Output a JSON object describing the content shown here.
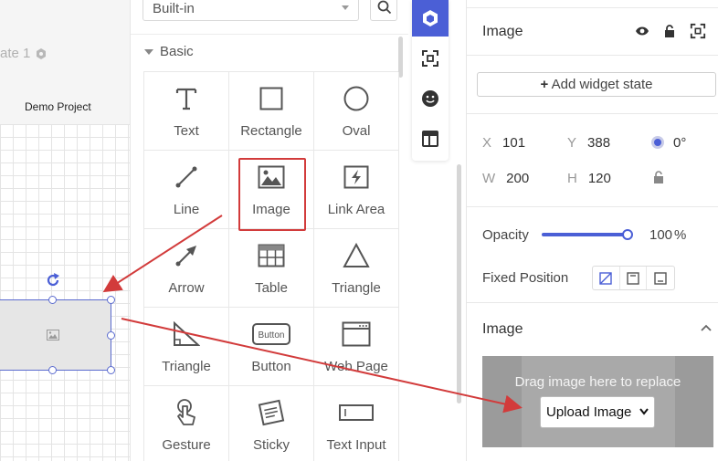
{
  "canvas": {
    "state_label": "ate 1",
    "project_name": "Demo Project"
  },
  "library": {
    "source_select": "Built-in",
    "section": "Basic",
    "widgets": [
      {
        "label": "Text",
        "icon": "text-icon"
      },
      {
        "label": "Rectangle",
        "icon": "rectangle-icon"
      },
      {
        "label": "Oval",
        "icon": "oval-icon"
      },
      {
        "label": "Line",
        "icon": "line-icon"
      },
      {
        "label": "Image",
        "icon": "image-icon"
      },
      {
        "label": "Link Area",
        "icon": "link-area-icon"
      },
      {
        "label": "Arrow",
        "icon": "arrow-icon"
      },
      {
        "label": "Table",
        "icon": "table-icon"
      },
      {
        "label": "Triangle",
        "icon": "triangle-icon"
      },
      {
        "label": "Triangle",
        "icon": "right-triangle-icon"
      },
      {
        "label": "Button",
        "icon": "button-icon"
      },
      {
        "label": "Web Page",
        "icon": "web-page-icon"
      },
      {
        "label": "Gesture",
        "icon": "gesture-icon"
      },
      {
        "label": "Sticky",
        "icon": "sticky-icon"
      },
      {
        "label": "Text Input",
        "icon": "text-input-icon"
      }
    ],
    "button_icon_text": "Button"
  },
  "toolstrip": [
    "widgets-cube-icon",
    "components-icon",
    "emoji-icon",
    "layout-icon"
  ],
  "props": {
    "title": "Image",
    "add_state": "Add widget state",
    "x_label": "X",
    "x": "101",
    "y_label": "Y",
    "y": "388",
    "rotation": "0°",
    "w_label": "W",
    "w": "200",
    "h_label": "H",
    "h": "120",
    "opacity_label": "Opacity",
    "opacity": "100",
    "opacity_unit": "%",
    "fixed_label": "Fixed Position",
    "image_section": "Image",
    "drop_text": "Drag image here to replace",
    "upload_label": "Upload Image"
  },
  "colors": {
    "accent": "#4b5fd6",
    "annotation": "#d23b3b"
  }
}
